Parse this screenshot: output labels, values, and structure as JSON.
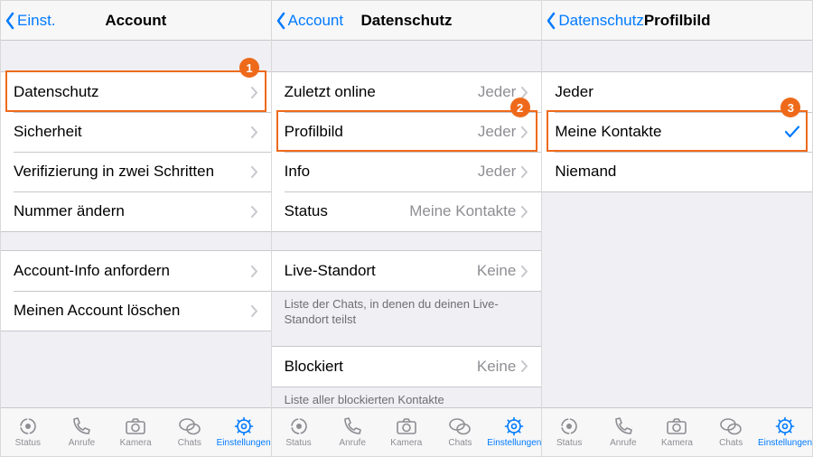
{
  "screens": [
    {
      "back_label": "Einst.",
      "title": "Account",
      "groups": [
        {
          "items": [
            {
              "label": "Datenschutz"
            },
            {
              "label": "Sicherheit"
            },
            {
              "label": "Verifizierung in zwei Schritten"
            },
            {
              "label": "Nummer ändern"
            }
          ]
        },
        {
          "items": [
            {
              "label": "Account-Info anfordern"
            },
            {
              "label": "Meinen Account löschen"
            }
          ]
        }
      ],
      "highlight": {
        "group": 0,
        "row": 0,
        "badge": "1"
      }
    },
    {
      "back_label": "Account",
      "title": "Datenschutz",
      "groups": [
        {
          "items": [
            {
              "label": "Zuletzt online",
              "value": "Jeder"
            },
            {
              "label": "Profilbild",
              "value": "Jeder"
            },
            {
              "label": "Info",
              "value": "Jeder"
            },
            {
              "label": "Status",
              "value": "Meine Kontakte"
            }
          ]
        },
        {
          "items": [
            {
              "label": "Live-Standort",
              "value": "Keine"
            }
          ],
          "footer": "Liste der Chats, in denen du deinen Live-Standort teilst"
        },
        {
          "items": [
            {
              "label": "Blockiert",
              "value": "Keine"
            }
          ],
          "footer": "Liste aller blockierten Kontakte"
        }
      ],
      "highlight": {
        "group": 0,
        "row": 1,
        "badge": "2"
      }
    },
    {
      "back_label": "Datenschutz",
      "title": "Profilbild",
      "groups": [
        {
          "items": [
            {
              "label": "Jeder"
            },
            {
              "label": "Meine Kontakte",
              "checked": true
            },
            {
              "label": "Niemand"
            }
          ]
        }
      ],
      "highlight": {
        "group": 0,
        "row": 1,
        "badge": "3"
      }
    }
  ],
  "tabs": [
    {
      "label": "Status",
      "icon": "status"
    },
    {
      "label": "Anrufe",
      "icon": "phone"
    },
    {
      "label": "Kamera",
      "icon": "camera"
    },
    {
      "label": "Chats",
      "icon": "chats"
    },
    {
      "label": "Einstellungen",
      "icon": "gear",
      "active": true
    }
  ]
}
